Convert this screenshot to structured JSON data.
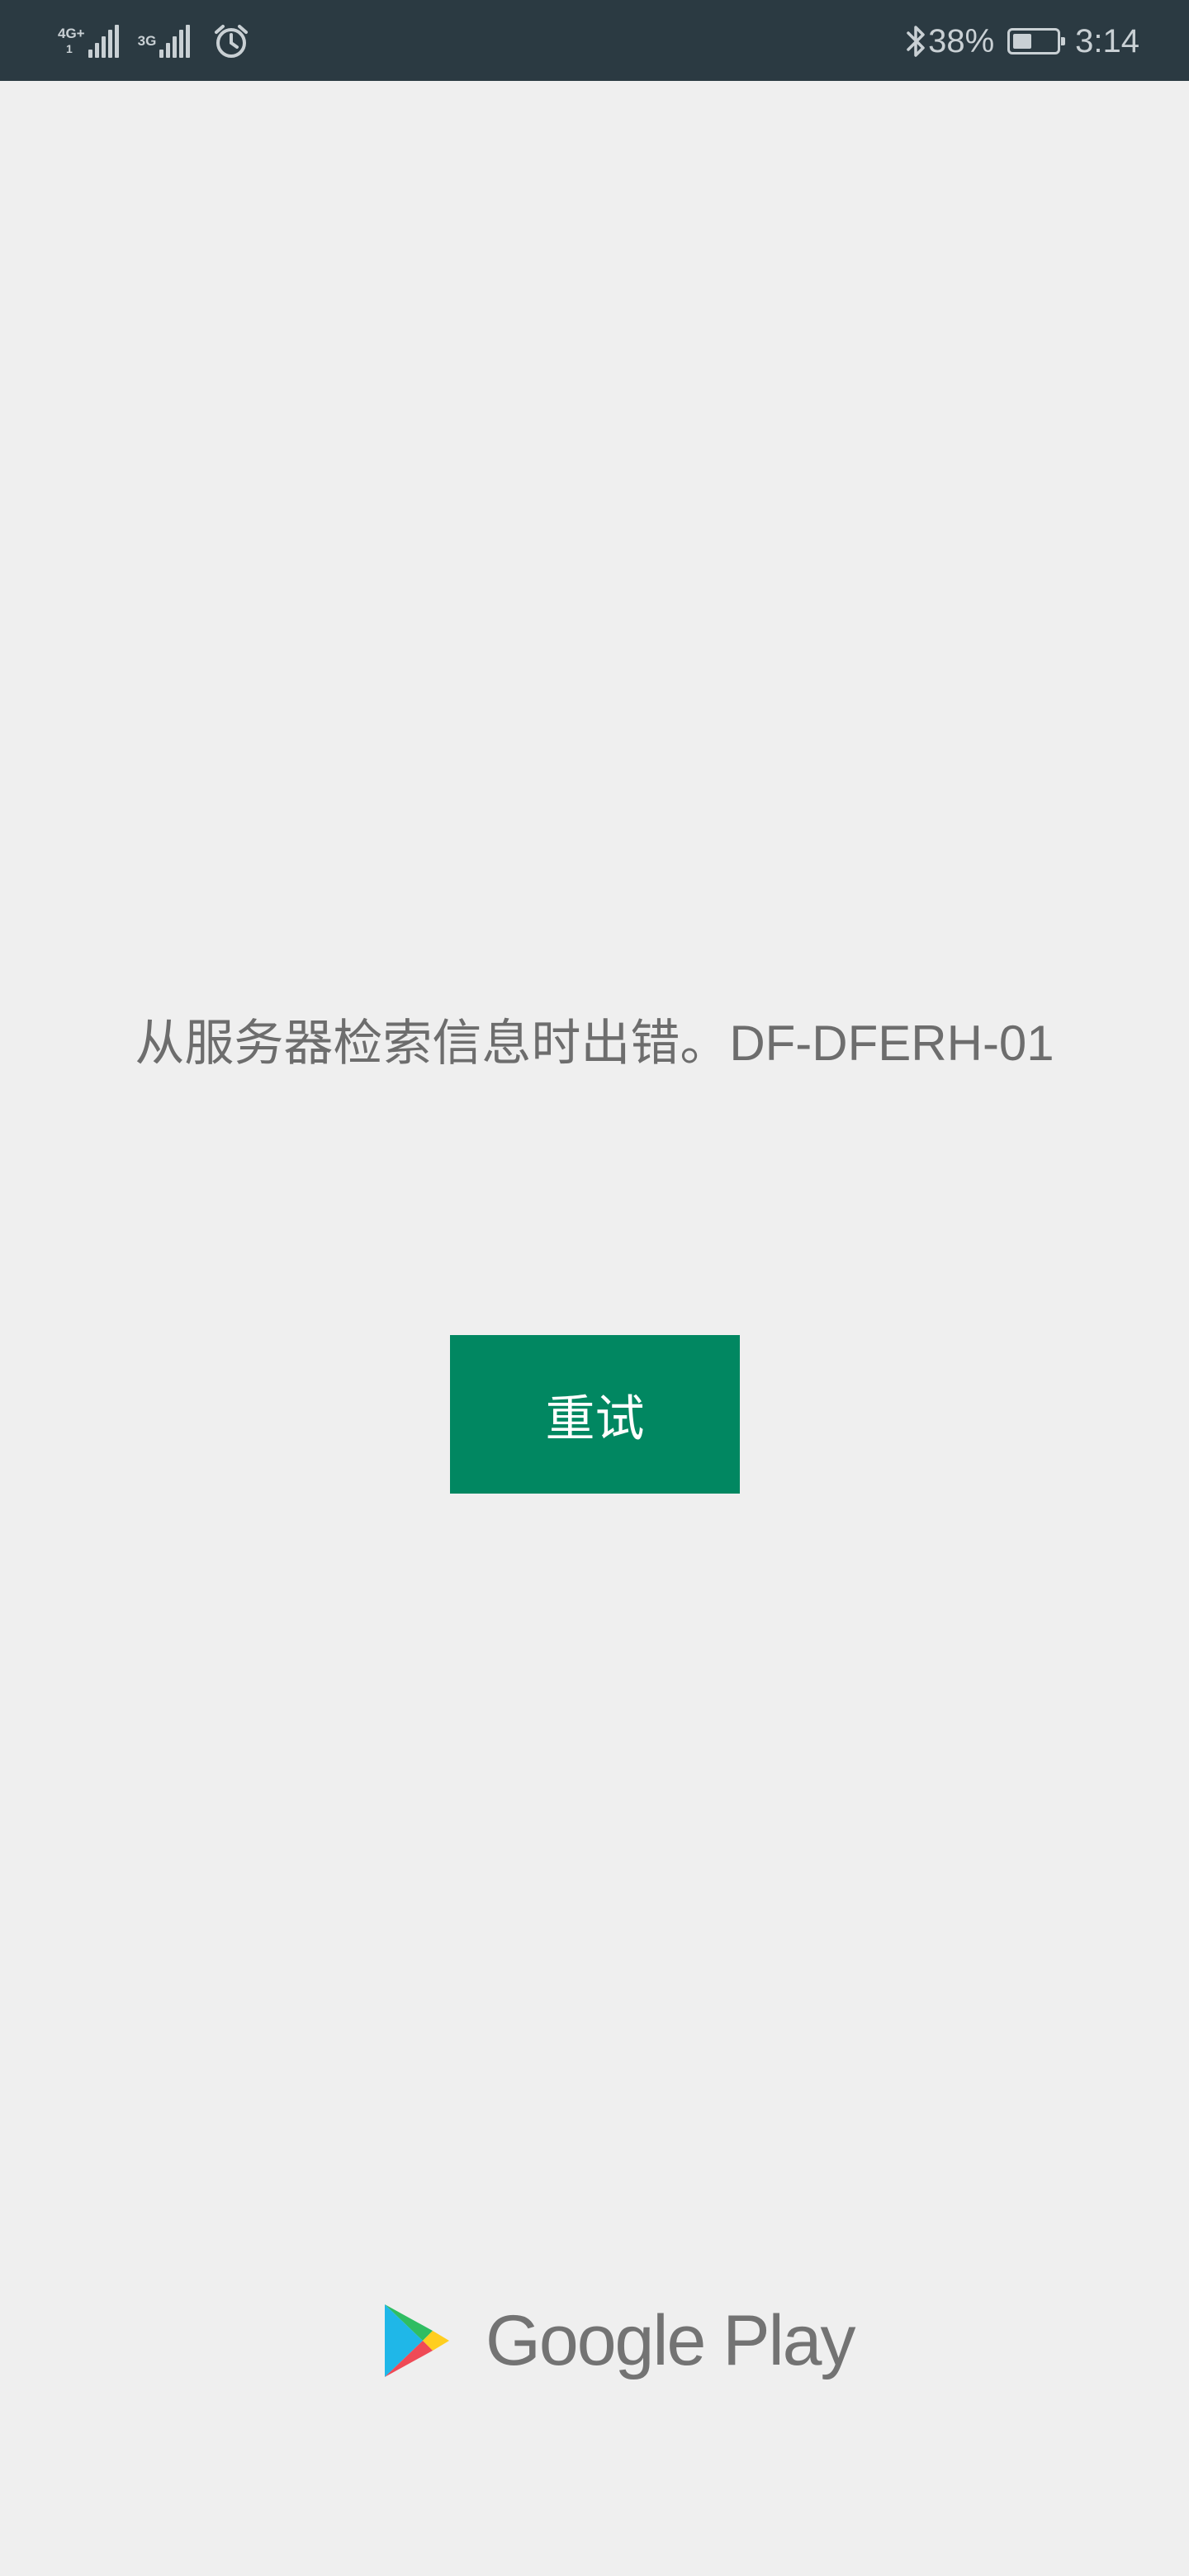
{
  "status_bar": {
    "network_primary": "4G+",
    "network_primary_sub": "1",
    "network_secondary": "3G",
    "battery_percent": "38%",
    "time": "3:14",
    "icons": [
      "signal-icon",
      "alarm-icon",
      "bluetooth-icon",
      "battery-icon"
    ]
  },
  "main": {
    "error_message": "从服务器检索信息时出错。DF-DFERH-01",
    "retry_label": "重试"
  },
  "footer": {
    "brand": "Google Play"
  },
  "colors": {
    "status_bar_bg": "#2b3a42",
    "page_bg": "#efefef",
    "button_bg": "#018761",
    "message_text": "#6d6d6d"
  }
}
